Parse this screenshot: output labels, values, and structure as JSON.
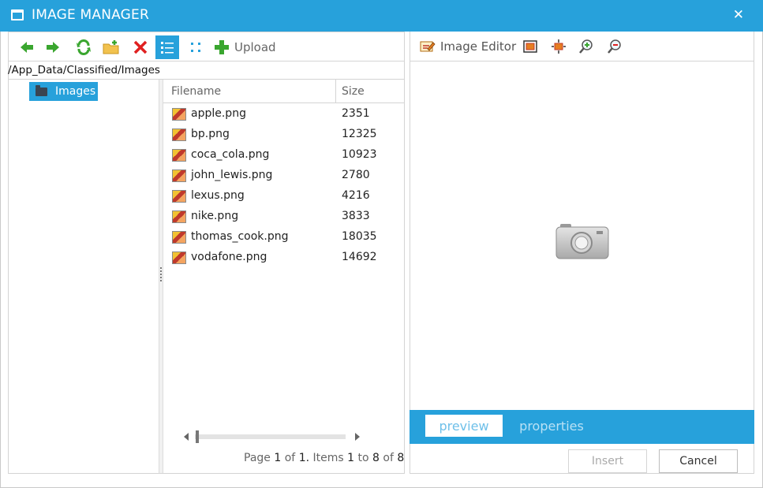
{
  "window": {
    "title": "IMAGE MANAGER",
    "close_glyph": "✕"
  },
  "toolbar": {
    "back_icon": "arrow-left-icon",
    "forward_icon": "arrow-right-icon",
    "refresh_icon": "refresh-icon",
    "new_folder_icon": "new-folder-icon",
    "delete_icon": "delete-icon",
    "list_view_icon": "list-view-icon",
    "thumb_view_icon": "thumbnail-view-icon",
    "upload_label": "Upload"
  },
  "path": "/App_Data/Classified/Images",
  "tree": {
    "items": [
      {
        "label": "Images",
        "selected": true
      }
    ]
  },
  "grid": {
    "columns": [
      "Filename",
      "Size"
    ],
    "rows": [
      {
        "name": "apple.png",
        "size": "2351"
      },
      {
        "name": "bp.png",
        "size": "12325"
      },
      {
        "name": "coca_cola.png",
        "size": "10923"
      },
      {
        "name": "john_lewis.png",
        "size": "2780"
      },
      {
        "name": "lexus.png",
        "size": "4216"
      },
      {
        "name": "nike.png",
        "size": "3833"
      },
      {
        "name": "thomas_cook.png",
        "size": "18035"
      },
      {
        "name": "vodafone.png",
        "size": "14692"
      }
    ]
  },
  "pager": {
    "page_word": "Page",
    "page": "1",
    "of_word": "of",
    "pages": "1.",
    "items_word": "Items",
    "from": "1",
    "to_word": "to",
    "to": "8",
    "of2_word": "of",
    "total": "8"
  },
  "preview_toolbar": {
    "image_editor_label": "Image Editor"
  },
  "tabs": [
    {
      "label": "preview",
      "selected": true
    },
    {
      "label": "properties",
      "selected": false
    }
  ],
  "buttons": {
    "insert": "Insert",
    "cancel": "Cancel"
  },
  "colors": {
    "accent": "#27a1db"
  }
}
